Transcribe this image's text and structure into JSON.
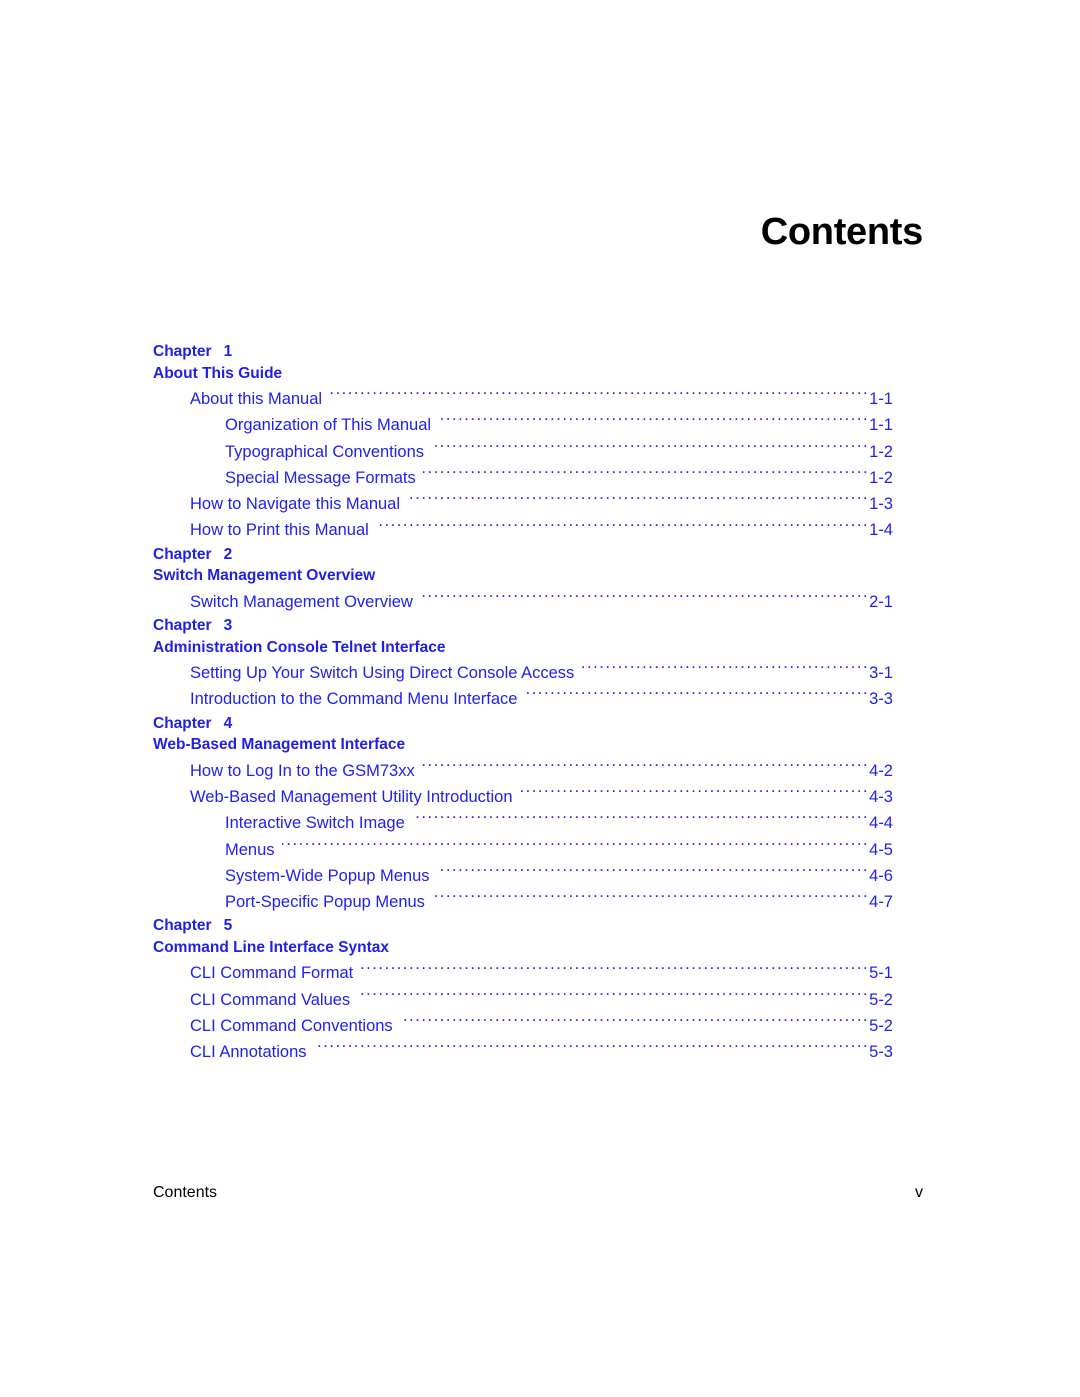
{
  "document": {
    "title": "Contents",
    "footer_left": "Contents",
    "footer_page": "v",
    "accent_color": "#2020f0",
    "heading_color": "#1f1fe8",
    "title_color": "#000000"
  },
  "chapters": [
    {
      "label": "Chapter",
      "number": "1",
      "title": "About This Guide",
      "entries": [
        {
          "label": "About this Manual",
          "page": "1-1",
          "level": 1
        },
        {
          "label": "Organization of This Manual",
          "page": "1-1",
          "level": 2
        },
        {
          "label": "Typographical Conventions",
          "page": "1-2",
          "level": 2
        },
        {
          "label": "Special Message Formats",
          "page": "1-2",
          "level": 2
        },
        {
          "label": "How to Navigate this Manual",
          "page": "1-3",
          "level": 1
        },
        {
          "label": "How to Print this Manual",
          "page": "1-4",
          "level": 1
        }
      ]
    },
    {
      "label": "Chapter",
      "number": "2",
      "title": "Switch Management Overview",
      "entries": [
        {
          "label": "Switch Management Overview",
          "page": "2-1",
          "level": 1
        }
      ]
    },
    {
      "label": "Chapter",
      "number": "3",
      "title": "Administration Console Telnet Interface",
      "entries": [
        {
          "label": "Setting Up Your Switch Using Direct Console Access",
          "page": "3-1",
          "level": 1
        },
        {
          "label": "Introduction to the Command Menu Interface",
          "page": "3-3",
          "level": 1
        }
      ]
    },
    {
      "label": "Chapter",
      "number": "4",
      "title": "Web-Based Management Interface",
      "entries": [
        {
          "label": "How to Log In to the GSM73xx",
          "page": "4-2",
          "level": 1
        },
        {
          "label": "Web-Based Management Utility Introduction",
          "page": "4-3",
          "level": 1
        },
        {
          "label": "Interactive Switch Image",
          "page": "4-4",
          "level": 2
        },
        {
          "label": "Menus",
          "page": "4-5",
          "level": 2
        },
        {
          "label": "System-Wide Popup Menus",
          "page": "4-6",
          "level": 2
        },
        {
          "label": "Port-Specific Popup Menus",
          "page": "4-7",
          "level": 2
        }
      ]
    },
    {
      "label": "Chapter",
      "number": "5",
      "title": "Command Line Interface Syntax",
      "entries": [
        {
          "label": "CLI Command Format",
          "page": "5-1",
          "level": 1
        },
        {
          "label": "CLI Command Values",
          "page": "5-2",
          "level": 1
        },
        {
          "label": "CLI Command Conventions",
          "page": "5-2",
          "level": 1
        },
        {
          "label": "CLI Annotations",
          "page": "5-3",
          "level": 1
        }
      ]
    }
  ]
}
